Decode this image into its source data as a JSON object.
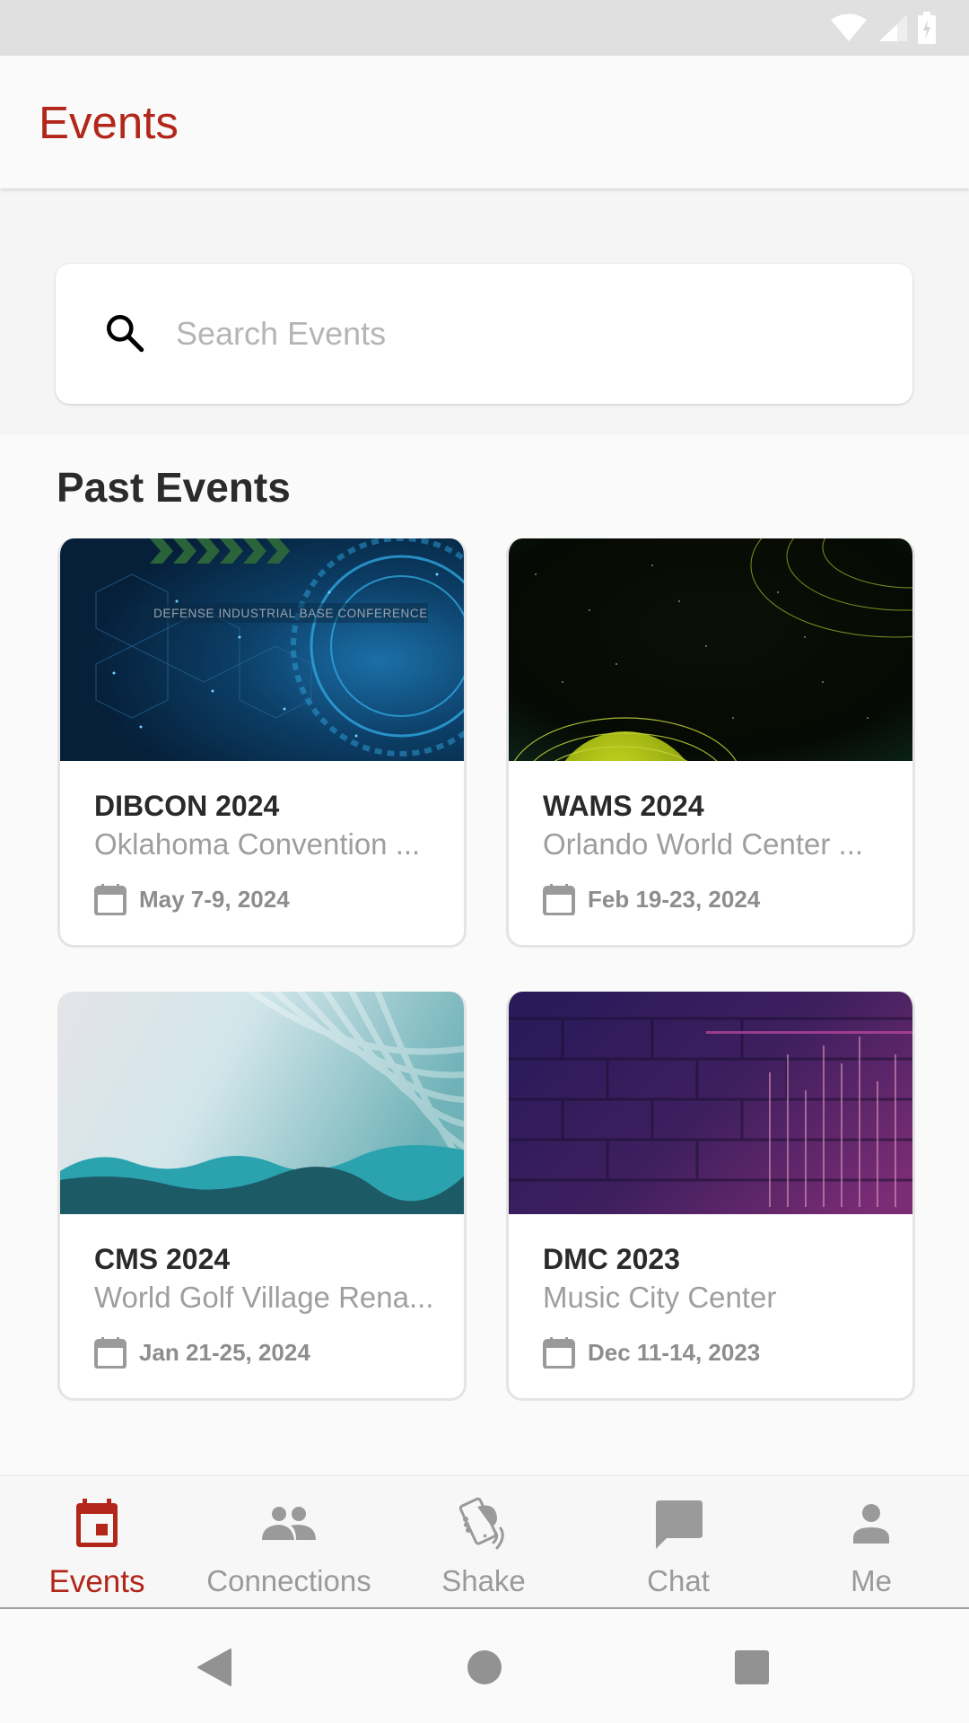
{
  "status_bar": {
    "icons": [
      "wifi-icon",
      "signal-icon",
      "battery-charging-icon"
    ]
  },
  "header": {
    "title": "Events"
  },
  "search": {
    "placeholder": "Search Events",
    "value": "",
    "icon": "search-icon"
  },
  "past_events": {
    "title": "Past Events",
    "events": [
      {
        "name": "DIBCON 2024",
        "venue": "Oklahoma Convention ...",
        "date": "May 7-9, 2024",
        "banner_text": "DEFENSE INDUSTRIAL BASE CONFERENCE",
        "theme": "blue-tech"
      },
      {
        "name": "WAMS 2024",
        "venue": "Orlando World Center ...",
        "date": "Feb 19-23, 2024",
        "banner_text": "",
        "theme": "green-globe"
      },
      {
        "name": "CMS 2024",
        "venue": "World Golf Village Rena...",
        "date": "Jan 21-25, 2024",
        "banner_text": "",
        "theme": "teal-waves"
      },
      {
        "name": "DMC 2023",
        "venue": "Music City Center",
        "date": "Dec 11-14, 2023",
        "banner_text": "",
        "theme": "purple-brick"
      }
    ]
  },
  "bottom_nav": {
    "items": [
      {
        "label": "Events",
        "icon": "calendar-icon",
        "active": true
      },
      {
        "label": "Connections",
        "icon": "people-icon",
        "active": false
      },
      {
        "label": "Shake",
        "icon": "shake-phone-icon",
        "active": false
      },
      {
        "label": "Chat",
        "icon": "chat-bubble-icon",
        "active": false
      },
      {
        "label": "Me",
        "icon": "person-icon",
        "active": false
      }
    ]
  },
  "system_nav": {
    "buttons": [
      "back",
      "home",
      "recents"
    ]
  },
  "colors": {
    "accent": "#b3261a",
    "inactive": "#9a9a9a",
    "title_text": "#2a2a2a",
    "secondary_text": "#9e9e9e"
  }
}
